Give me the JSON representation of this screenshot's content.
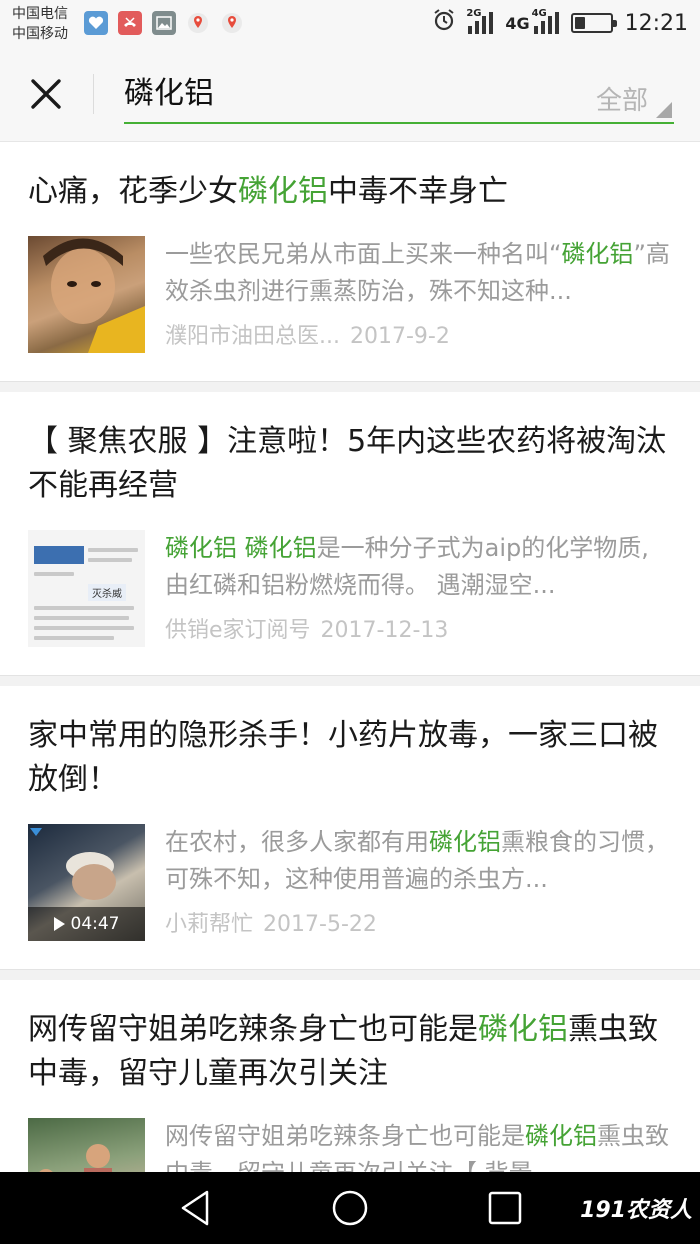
{
  "status_bar": {
    "carrier_1": "中国电信",
    "carrier_2": "中国移动",
    "time": "12:21",
    "network_1": "2G",
    "network_2": "4G",
    "network_3": "4G",
    "battery_level": 0.3,
    "notification_icons": [
      "health-app-icon",
      "missed-call-icon",
      "gallery-icon",
      "map-pin-icon",
      "map-pin-icon"
    ]
  },
  "search": {
    "query": "磷化铝",
    "scope_label": "全部"
  },
  "results": [
    {
      "title_pre": "心痛，花季少女",
      "title_hl": "磷化铝",
      "title_post": "中毒不幸身亡",
      "snippet_pre": "一些农民兄弟从市面上买来一种名叫“",
      "snippet_hl": "磷化铝",
      "snippet_post": "”高效杀虫剂进行熏蒸防治，殊不知这种...",
      "source": "濮阳市油田总医...",
      "date": "2017-9-2"
    },
    {
      "title_pre": "【 聚焦农服 】注意啦！5年内这些农药将被淘汰不能再经营",
      "title_hl": "",
      "title_post": "",
      "snippet_pre": "",
      "snippet_hl": "磷化铝 磷化铝",
      "snippet_post": "是一种分子式为aip的化学物质,由红磷和铝粉燃烧而得。 遇潮湿空...",
      "source": "供销e家订阅号",
      "date": "2017-12-13",
      "thumb_tag": "灭杀威"
    },
    {
      "title_pre": "家中常用的隐形杀手！小药片放毒，一家三口被放倒！",
      "title_hl": "",
      "title_post": "",
      "snippet_pre": "在农村，很多人家都有用",
      "snippet_hl": "磷化铝",
      "snippet_post": "熏粮食的习惯，可殊不知，这种使用普遍的杀虫方...",
      "source": "小莉帮忙",
      "date": "2017-5-22",
      "video_duration": "04:47"
    },
    {
      "title_pre": "网传留守姐弟吃辣条身亡也可能是",
      "title_hl": "磷化铝",
      "title_post": "熏虫致中毒，留守儿童再次引关注",
      "snippet_pre": "网传留守姐弟吃辣条身亡也可能是",
      "snippet_hl": "磷化铝",
      "snippet_post": "熏虫致中毒，留守儿童再次引关注【 背景...",
      "source": "",
      "date": ""
    }
  ],
  "watermark": "191农资人",
  "colors": {
    "highlight": "#45a335",
    "accent_underline": "#45b035",
    "snippet_text": "#9b9b9b",
    "meta_text": "#c4c4c4"
  }
}
